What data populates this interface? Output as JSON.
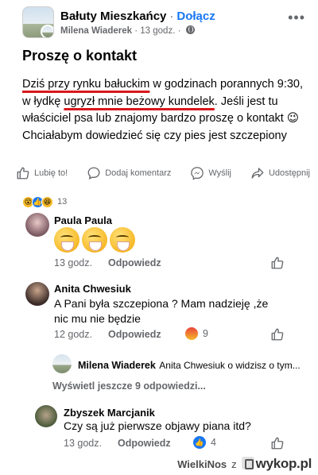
{
  "header": {
    "group_name": "Bałuty Mieszkańcy",
    "separator": "·",
    "join_label": "Dołącz",
    "author": "Milena Wiaderek",
    "time": "13 godz.",
    "more_icon": "more-horizontal-icon",
    "privacy_icon": "globe-icon"
  },
  "post": {
    "title": "Proszę o kontakt",
    "text_part1": "Dziś przy rynku bałuckim",
    "text_part2": " w godzinach porannych 9:30, w łydkę ",
    "text_part3": "ugryzł mnie beżowy kundelek",
    "text_part4": ". Jeśli jest tu właściciel psa lub znajomy bardzo proszę o kontakt 😉 Chciałabym dowiedzieć się czy pies jest szczepiony",
    "underline_color": "#d9171c"
  },
  "actions": {
    "like": "Lubię to!",
    "comment": "Dodaj komentarz",
    "send": "Wyślij",
    "share": "Udostępnij"
  },
  "reactions": {
    "count": "13",
    "types": [
      "wow",
      "like",
      "haha"
    ]
  },
  "comments": [
    {
      "name": "Paula Paula",
      "emojis": "🤭🤭🤭",
      "time": "13 godz.",
      "reply": "Odpowiedz"
    },
    {
      "name": "Anita Chwesiuk",
      "text_line1": "A Pani była szczepiona ? Mam nadzieję ,że",
      "text_line2": "nic mu nie będzie",
      "time": "12 godz.",
      "reply": "Odpowiedz",
      "reaction_count": "9",
      "reaction_icon": "angry-emoji-icon"
    },
    {
      "name": "Milena Wiaderek",
      "preview": "Anita Chwesiuk o widzisz o tym..."
    },
    {
      "more_replies": "Wyświetl jeszcze 9 odpowiedzi..."
    },
    {
      "name": "Zbyszek Marcjanik",
      "text": "Czy są już pierwsze objawy piana itd?",
      "time": "13 godz.",
      "reply": "Odpowiedz",
      "reaction_count": "4",
      "reaction_icon": "like-icon"
    }
  ],
  "watermark": {
    "user": "WielkiNos",
    "z": "z",
    "site": "wykop.pl"
  },
  "colors": {
    "facebook_blue": "#1877f2",
    "secondary_text": "#65676b",
    "angry_red": "#e9710f"
  }
}
